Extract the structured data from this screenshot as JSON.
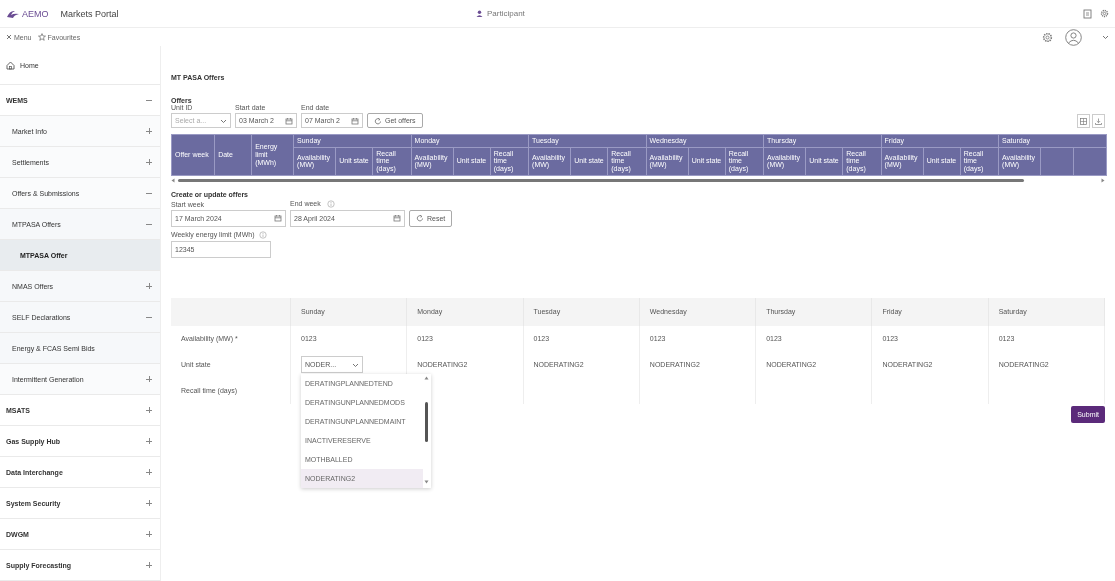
{
  "header": {
    "logo": "AEMO",
    "app_title": "Markets Portal",
    "role": "Participant"
  },
  "toolbar": {
    "menu": "Menu",
    "favourites": "Favourites"
  },
  "sidebar": {
    "items": [
      {
        "label": "Home",
        "kind": "home",
        "selected": false
      },
      {
        "label": "WEMS",
        "kind": "section",
        "selected": false,
        "expanded": true,
        "children": [
          {
            "label": "Market Info",
            "kind": "group",
            "selected": false,
            "expanded": false
          },
          {
            "label": "Settlements",
            "kind": "group",
            "selected": false,
            "expanded": false
          },
          {
            "label": "Offers & Submissions",
            "kind": "group",
            "selected": false,
            "expanded": true,
            "children": [
              {
                "label": "MTPASA Offers",
                "kind": "group",
                "selected": false,
                "expanded": true,
                "children": [
                  {
                    "label": "MTPASA Offer",
                    "selected": true
                  }
                ]
              },
              {
                "label": "NMAS Offers",
                "kind": "group",
                "selected": false,
                "expanded": false
              },
              {
                "label": "SELF Declarations",
                "kind": "group",
                "selected": false,
                "expanded": true
              },
              {
                "label": "Energy & FCAS Semi Bids",
                "kind": "leaf",
                "selected": false
              }
            ]
          },
          {
            "label": "Intermittent Generation",
            "kind": "group",
            "selected": false,
            "expanded": false
          }
        ]
      },
      {
        "label": "MSATS",
        "kind": "section",
        "selected": false,
        "expanded": false
      },
      {
        "label": "Gas Supply Hub",
        "kind": "section",
        "selected": false,
        "expanded": false
      },
      {
        "label": "Data Interchange",
        "kind": "section",
        "selected": false,
        "expanded": false
      },
      {
        "label": "System Security",
        "kind": "section",
        "selected": false,
        "expanded": false
      },
      {
        "label": "DWGM",
        "kind": "section",
        "selected": false,
        "expanded": false
      },
      {
        "label": "Supply Forecasting",
        "kind": "section",
        "selected": false,
        "expanded": false
      }
    ]
  },
  "page_title": "MT PASA Offers",
  "offers": {
    "heading": "Offers",
    "filters": [
      {
        "label": "Unit ID",
        "kind": "select",
        "placeholder": "Select a..."
      },
      {
        "label": "Start date",
        "kind": "date",
        "value": "03 March 2"
      },
      {
        "label": "End date",
        "kind": "date",
        "value": "07 March 2"
      }
    ],
    "button": "Get offers",
    "table": {
      "columns": [
        "Offer week",
        "Date",
        "Energy limit (MWh)"
      ],
      "day_groups": [
        {
          "day": "Sunday",
          "columns": [
            "Availability (MW)",
            "Unit state",
            "Recall time (days)"
          ]
        },
        {
          "day": "Monday",
          "columns": [
            "Availability (MW)",
            "Unit state",
            "Recall time (days)"
          ]
        },
        {
          "day": "Tuesday",
          "columns": [
            "Availability (MW)",
            "Unit state",
            "Recall time (days)"
          ]
        },
        {
          "day": "Wednesday",
          "columns": [
            "Availability (MW)",
            "Unit state",
            "Recall time (days)"
          ]
        },
        {
          "day": "Thursday",
          "columns": [
            "Availability (MW)",
            "Unit state",
            "Recall time (days)"
          ]
        },
        {
          "day": "Friday",
          "columns": [
            "Availability (MW)",
            "Unit state",
            "Recall time (days)"
          ]
        },
        {
          "day": "Saturday",
          "columns": [
            "Availability (MW)"
          ]
        }
      ]
    }
  },
  "create": {
    "heading": "Create or update offers",
    "fields": [
      {
        "label": "Start week",
        "kind": "date",
        "value": "17 March 2024"
      },
      {
        "label": "End week",
        "kind": "date",
        "value": "28 April 2024",
        "info": true
      }
    ],
    "button": "Reset",
    "energy": {
      "label": "Weekly energy limit (MWh)",
      "value": "12345",
      "info": true
    },
    "grid": {
      "days": [
        "Sunday",
        "Monday",
        "Tuesday",
        "Wednesday",
        "Thursday",
        "Friday",
        "Saturday"
      ],
      "rows": [
        {
          "label": "Availability (MW) *",
          "cells": [
            "0123",
            "0123",
            "0123",
            "0123",
            "0123",
            "0123",
            "0123"
          ]
        },
        {
          "label": "Unit state",
          "cells": [
            {
              "kind": "select",
              "value": "NODER...",
              "open": true,
              "options": [
                {
                  "label": "DERATINGPLANNEDTEND",
                  "selected": false
                },
                {
                  "label": "DERATINGUNPLANNEDMODS",
                  "selected": false
                },
                {
                  "label": "DERATINGUNPLANNEDMAINT",
                  "selected": false
                },
                {
                  "label": "INACTIVERESERVE",
                  "selected": false
                },
                {
                  "label": "MOTHBALLED",
                  "selected": false
                },
                {
                  "label": "NODERATING2",
                  "selected": true
                }
              ]
            },
            "NODERATING2",
            "NODERATING2",
            "NODERATING2",
            "NODERATING2",
            "NODERATING2",
            "NODERATING2"
          ]
        },
        {
          "label": "Recall time (days)"
        }
      ]
    },
    "submit": "Submit"
  }
}
